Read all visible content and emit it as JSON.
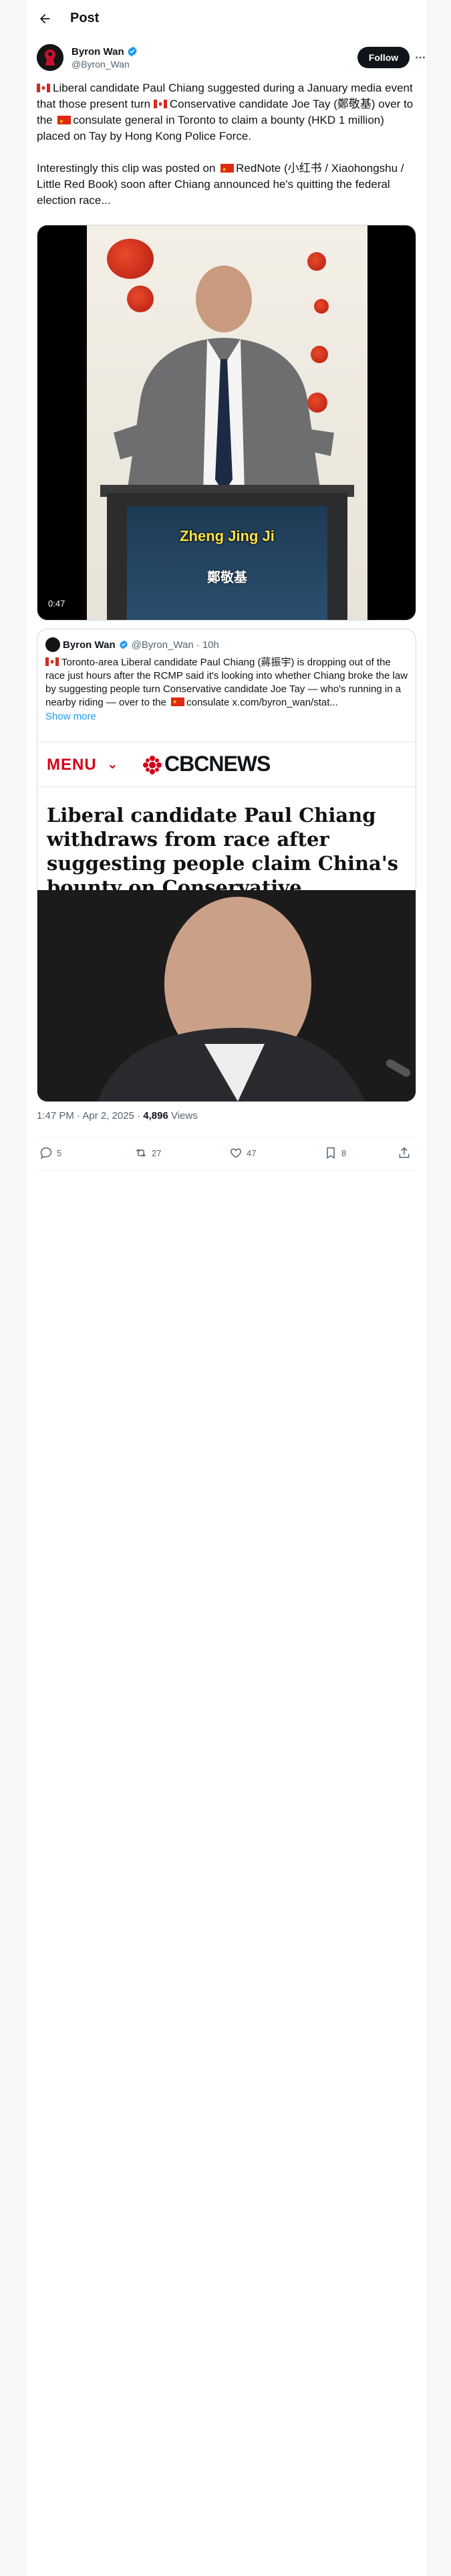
{
  "topbar": {
    "title": "Post"
  },
  "author": {
    "name": "Byron Wan",
    "handle": "@Byron_Wan",
    "follow_label": "Follow"
  },
  "post": {
    "p1_a": "Liberal candidate Paul Chiang suggested during a January media event that those present turn ",
    "p1_b": "Conservative candidate Joe Tay (鄭敬基) over to the ",
    "p1_c": "consulate general in Toronto to claim a bounty (HKD 1 million) placed on Tay by Hong Kong Police Force.",
    "p2_a": "Interestingly this clip was posted on ",
    "p2_b": "RedNote (小红书 / Xiaohongshu / Little Red Book) soon after Chiang announced he's quitting the federal election race..."
  },
  "video": {
    "caption_zh1": "Zheng Jing Ji",
    "caption_zh2": "鄭敬基",
    "duration": "0:47"
  },
  "quote": {
    "name": "Byron Wan",
    "handle": "@Byron_Wan",
    "time": "· 10h",
    "text_a": "Toronto-area Liberal candidate Paul Chiang (蔣振宇) is dropping out of the race just hours after the RCMP said it's looking into whether Chiang broke the law by suggesting people turn Conservative candidate Joe Tay — who's running in a nearby riding — over to the ",
    "text_b": "consulate  x.com/byron_wan/stat...",
    "show_more": "Show more",
    "cbc_menu": "MENU",
    "cbc_logo": "CBCNEWS",
    "headline": "Liberal candidate Paul Chiang withdraws from race after suggesting people claim China's bounty on Conservative"
  },
  "meta": {
    "time": "1:47 PM · Apr 2, 2025 · ",
    "views": "4,896",
    "views_label": " Views"
  },
  "actions": {
    "replies": "5",
    "reposts": "27",
    "likes": "47",
    "bookmarks": "8"
  },
  "colors": {
    "accent": "#1d9bf0",
    "cbc_red": "#d4001a",
    "text": "#0f1419",
    "muted": "#536471"
  }
}
